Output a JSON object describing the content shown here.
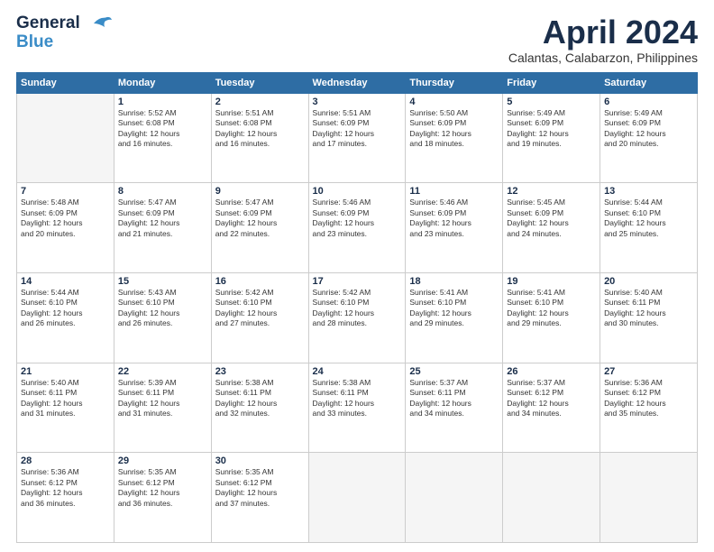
{
  "logo": {
    "line1": "General",
    "line2": "Blue"
  },
  "title": "April 2024",
  "location": "Calantas, Calabarzon, Philippines",
  "days_of_week": [
    "Sunday",
    "Monday",
    "Tuesday",
    "Wednesday",
    "Thursday",
    "Friday",
    "Saturday"
  ],
  "weeks": [
    [
      {
        "day": "",
        "info": ""
      },
      {
        "day": "1",
        "info": "Sunrise: 5:52 AM\nSunset: 6:08 PM\nDaylight: 12 hours\nand 16 minutes."
      },
      {
        "day": "2",
        "info": "Sunrise: 5:51 AM\nSunset: 6:08 PM\nDaylight: 12 hours\nand 16 minutes."
      },
      {
        "day": "3",
        "info": "Sunrise: 5:51 AM\nSunset: 6:09 PM\nDaylight: 12 hours\nand 17 minutes."
      },
      {
        "day": "4",
        "info": "Sunrise: 5:50 AM\nSunset: 6:09 PM\nDaylight: 12 hours\nand 18 minutes."
      },
      {
        "day": "5",
        "info": "Sunrise: 5:49 AM\nSunset: 6:09 PM\nDaylight: 12 hours\nand 19 minutes."
      },
      {
        "day": "6",
        "info": "Sunrise: 5:49 AM\nSunset: 6:09 PM\nDaylight: 12 hours\nand 20 minutes."
      }
    ],
    [
      {
        "day": "7",
        "info": "Sunrise: 5:48 AM\nSunset: 6:09 PM\nDaylight: 12 hours\nand 20 minutes."
      },
      {
        "day": "8",
        "info": "Sunrise: 5:47 AM\nSunset: 6:09 PM\nDaylight: 12 hours\nand 21 minutes."
      },
      {
        "day": "9",
        "info": "Sunrise: 5:47 AM\nSunset: 6:09 PM\nDaylight: 12 hours\nand 22 minutes."
      },
      {
        "day": "10",
        "info": "Sunrise: 5:46 AM\nSunset: 6:09 PM\nDaylight: 12 hours\nand 23 minutes."
      },
      {
        "day": "11",
        "info": "Sunrise: 5:46 AM\nSunset: 6:09 PM\nDaylight: 12 hours\nand 23 minutes."
      },
      {
        "day": "12",
        "info": "Sunrise: 5:45 AM\nSunset: 6:09 PM\nDaylight: 12 hours\nand 24 minutes."
      },
      {
        "day": "13",
        "info": "Sunrise: 5:44 AM\nSunset: 6:10 PM\nDaylight: 12 hours\nand 25 minutes."
      }
    ],
    [
      {
        "day": "14",
        "info": "Sunrise: 5:44 AM\nSunset: 6:10 PM\nDaylight: 12 hours\nand 26 minutes."
      },
      {
        "day": "15",
        "info": "Sunrise: 5:43 AM\nSunset: 6:10 PM\nDaylight: 12 hours\nand 26 minutes."
      },
      {
        "day": "16",
        "info": "Sunrise: 5:42 AM\nSunset: 6:10 PM\nDaylight: 12 hours\nand 27 minutes."
      },
      {
        "day": "17",
        "info": "Sunrise: 5:42 AM\nSunset: 6:10 PM\nDaylight: 12 hours\nand 28 minutes."
      },
      {
        "day": "18",
        "info": "Sunrise: 5:41 AM\nSunset: 6:10 PM\nDaylight: 12 hours\nand 29 minutes."
      },
      {
        "day": "19",
        "info": "Sunrise: 5:41 AM\nSunset: 6:10 PM\nDaylight: 12 hours\nand 29 minutes."
      },
      {
        "day": "20",
        "info": "Sunrise: 5:40 AM\nSunset: 6:11 PM\nDaylight: 12 hours\nand 30 minutes."
      }
    ],
    [
      {
        "day": "21",
        "info": "Sunrise: 5:40 AM\nSunset: 6:11 PM\nDaylight: 12 hours\nand 31 minutes."
      },
      {
        "day": "22",
        "info": "Sunrise: 5:39 AM\nSunset: 6:11 PM\nDaylight: 12 hours\nand 31 minutes."
      },
      {
        "day": "23",
        "info": "Sunrise: 5:38 AM\nSunset: 6:11 PM\nDaylight: 12 hours\nand 32 minutes."
      },
      {
        "day": "24",
        "info": "Sunrise: 5:38 AM\nSunset: 6:11 PM\nDaylight: 12 hours\nand 33 minutes."
      },
      {
        "day": "25",
        "info": "Sunrise: 5:37 AM\nSunset: 6:11 PM\nDaylight: 12 hours\nand 34 minutes."
      },
      {
        "day": "26",
        "info": "Sunrise: 5:37 AM\nSunset: 6:12 PM\nDaylight: 12 hours\nand 34 minutes."
      },
      {
        "day": "27",
        "info": "Sunrise: 5:36 AM\nSunset: 6:12 PM\nDaylight: 12 hours\nand 35 minutes."
      }
    ],
    [
      {
        "day": "28",
        "info": "Sunrise: 5:36 AM\nSunset: 6:12 PM\nDaylight: 12 hours\nand 36 minutes."
      },
      {
        "day": "29",
        "info": "Sunrise: 5:35 AM\nSunset: 6:12 PM\nDaylight: 12 hours\nand 36 minutes."
      },
      {
        "day": "30",
        "info": "Sunrise: 5:35 AM\nSunset: 6:12 PM\nDaylight: 12 hours\nand 37 minutes."
      },
      {
        "day": "",
        "info": ""
      },
      {
        "day": "",
        "info": ""
      },
      {
        "day": "",
        "info": ""
      },
      {
        "day": "",
        "info": ""
      }
    ]
  ]
}
